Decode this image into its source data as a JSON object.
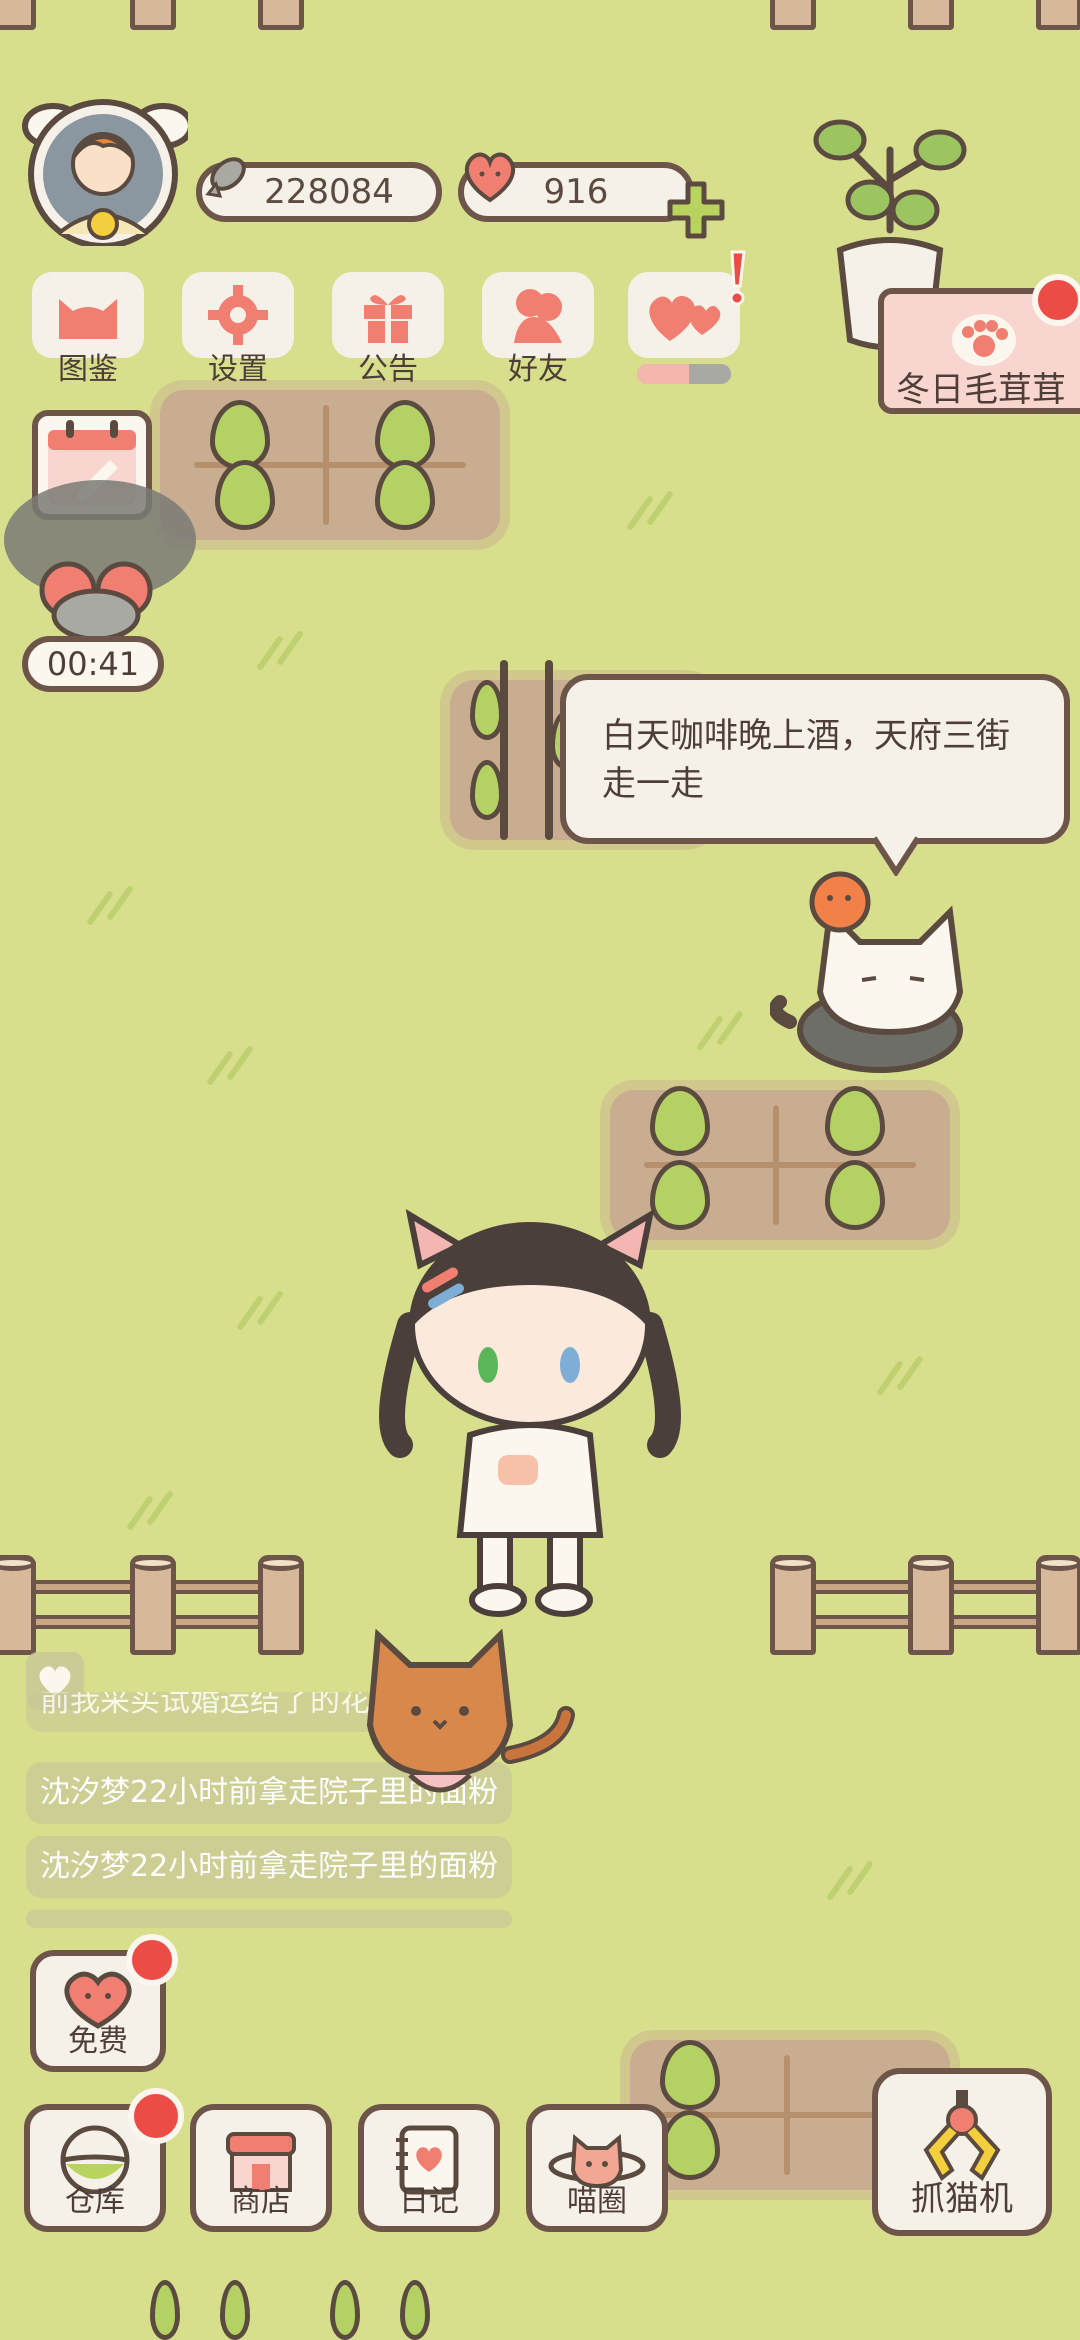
{
  "colors": {
    "grass": "#d7de8c",
    "outline": "#6d5549",
    "panel": "#f6f1e8",
    "accent_pink": "#f07f72",
    "badge_red": "#ec4c46"
  },
  "currency": {
    "fish_icon": "fish-icon",
    "fish_amount": "228084",
    "heart_icon": "heart-face-icon",
    "heart_amount": "916",
    "add_icon": "plus-icon"
  },
  "menu": [
    {
      "label": "图鉴",
      "icon": "cat-head-icon"
    },
    {
      "label": "设置",
      "icon": "gear-icon"
    },
    {
      "label": "公告",
      "icon": "gift-icon"
    },
    {
      "label": "好友",
      "icon": "friends-icon"
    },
    {
      "label": "",
      "icon": "hearts-icon"
    }
  ],
  "event": {
    "label": "冬日毛茸茸",
    "icon": "paw-icon"
  },
  "timer": {
    "value": "00:41"
  },
  "speech": {
    "text": "白天咖啡晚上酒，天府三街走一走"
  },
  "feed": [
    {
      "text": "前我采买试婚运结了的花花"
    },
    {
      "text": "沈汐梦22小时前拿走院子里的面粉"
    },
    {
      "text": "沈汐梦22小时前拿走院子里的面粉"
    }
  ],
  "free": {
    "label": "免费"
  },
  "bottom": [
    {
      "label": "仓库",
      "icon": "warehouse-icon"
    },
    {
      "label": "商店",
      "icon": "shop-icon"
    },
    {
      "label": "日记",
      "icon": "diary-icon"
    },
    {
      "label": "喵圈",
      "icon": "cat-planet-icon"
    }
  ],
  "claw": {
    "label": "抓猫机",
    "icon": "claw-icon"
  }
}
